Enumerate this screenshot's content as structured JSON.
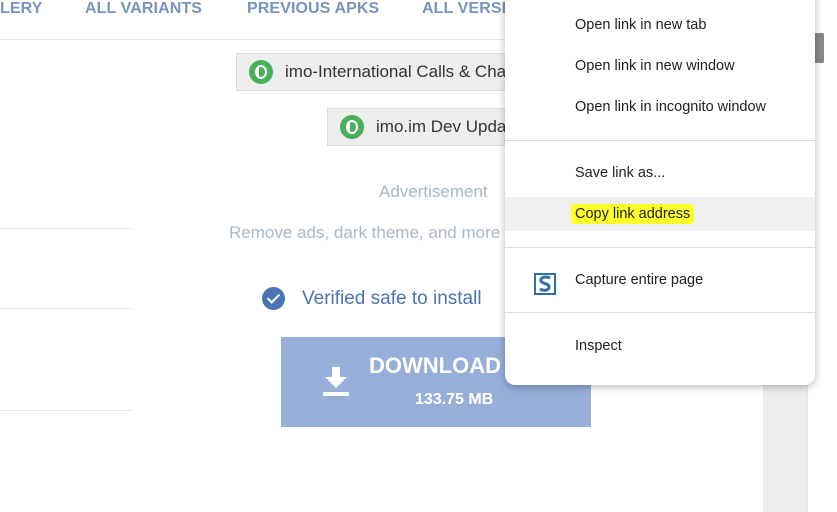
{
  "nav": {
    "items": [
      "LERY",
      "ALL VARIANTS",
      "PREVIOUS APKS",
      "ALL VERSI"
    ]
  },
  "dev_links": [
    {
      "icon": "developer-icon",
      "label": "imo-International Calls & Cha"
    },
    {
      "icon": "developer-icon",
      "label": "imo.im Dev Upda"
    }
  ],
  "advertisement": {
    "label": "Advertisement",
    "remove_ads": "Remove ads, dark theme, and more"
  },
  "verified": {
    "icon": "check-circle-icon",
    "text": "Verified safe to install"
  },
  "download": {
    "label": "DOWNLOAD A",
    "size": "133.75 MB",
    "color": "#97aed9"
  },
  "context_menu": {
    "open_new_tab": "Open link in new tab",
    "open_new_window": "Open link in new window",
    "open_incognito": "Open link in incognito window",
    "save_link_as": "Save link as...",
    "copy_link_address": "Copy link address",
    "capture_entire_page": "Capture entire page",
    "inspect": "Inspect",
    "highlight_color": "#ffff2a"
  },
  "colors": {
    "accent": "#4b74b6",
    "nav_text": "#7a93bf",
    "brand_green": "#4bae5b"
  }
}
